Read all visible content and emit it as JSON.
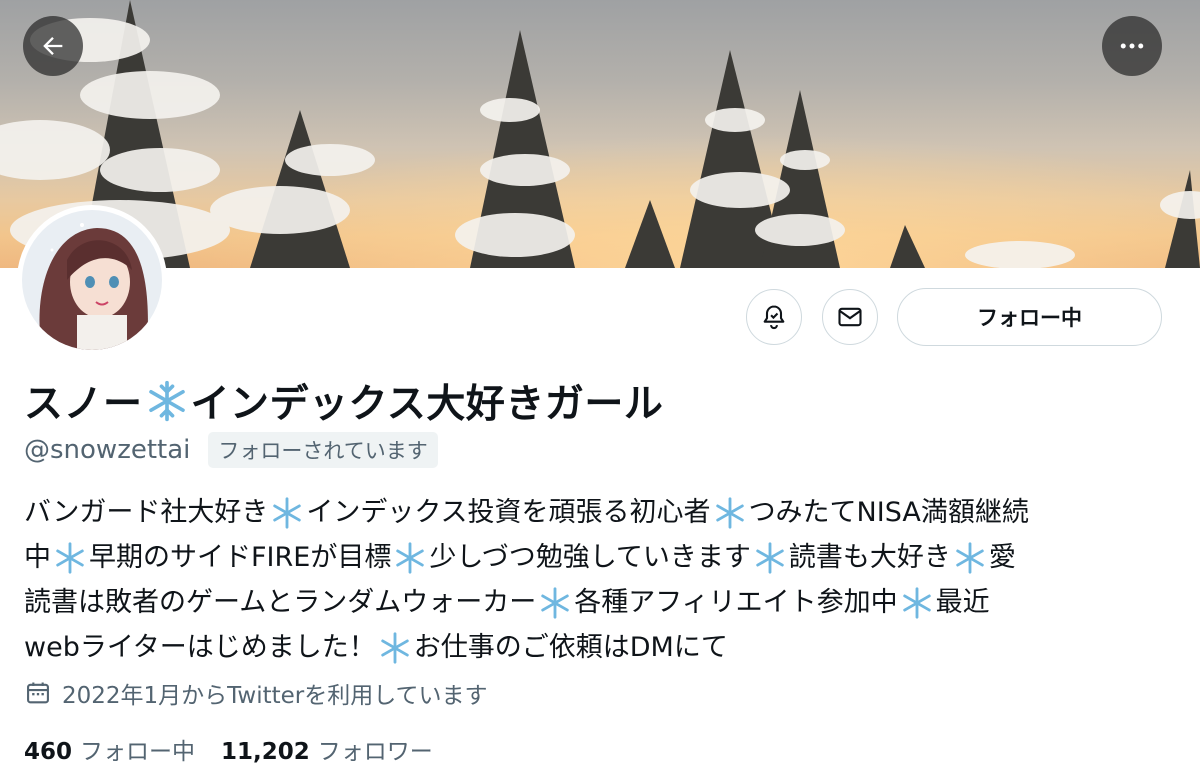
{
  "profile": {
    "display_name_parts": [
      "スノー",
      "インデックス大好きガール"
    ],
    "handle": "@snowzettai",
    "follows_you_badge": "フォローされています",
    "follow_button_label": "フォロー中",
    "bio_lines": [
      [
        "バンガード社大好き",
        "インデックス投資を頑張る初心者",
        "つみたてNISA満額継続"
      ],
      [
        "中",
        "早期のサイドFIREが目標",
        "少しづつ勉強していきます",
        "読書も大好き",
        "愛"
      ],
      [
        "読書は敗者のゲームとランダムウォーカー",
        "各種アフィリエイト参加中",
        "最近"
      ],
      [
        "webライターはじめました！",
        "お仕事のご依頼はDMにて"
      ]
    ],
    "joined_text": "2022年1月からTwitterを利用しています",
    "following_count": "460",
    "following_label": "フォロー中",
    "followers_count": "11,202",
    "followers_label": "フォロワー"
  },
  "icons": {
    "back": "back-arrow-icon",
    "more": "more-dots-icon",
    "bell": "notification-bell-icon",
    "mail": "mail-icon",
    "calendar": "calendar-icon",
    "inline_emoji": "snowflake-icon"
  },
  "colors": {
    "text_primary": "#0f1419",
    "text_secondary": "#536471",
    "border": "#cfd9de",
    "badge_bg": "#eff3f4",
    "snowflake": "#6fb7e0"
  }
}
